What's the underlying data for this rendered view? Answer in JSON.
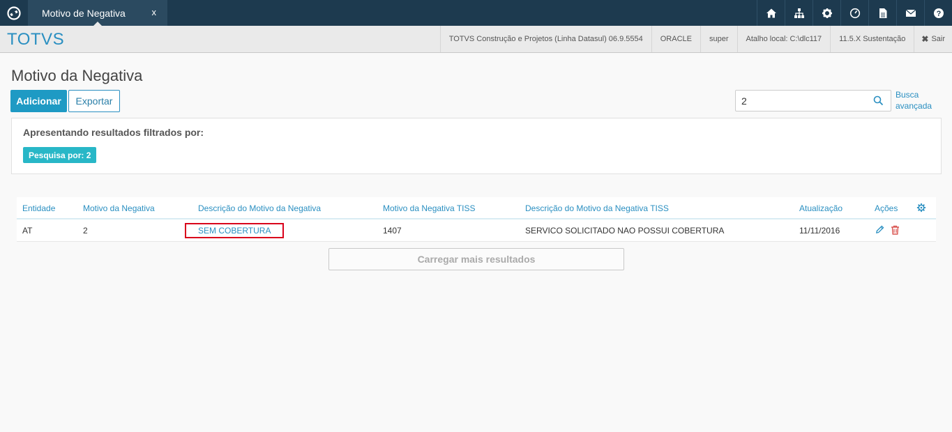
{
  "topbar": {
    "tab_title": "Motivo de Negativa",
    "tab_close": "x",
    "icons": [
      "home-icon",
      "sitemap-icon",
      "gear-icon",
      "clock-icon",
      "document-icon",
      "mail-icon",
      "help-icon"
    ]
  },
  "header": {
    "brand": "TOTVS",
    "product": "TOTVS Construção e Projetos (Linha Datasul) 06.9.5554",
    "database": "ORACLE",
    "user": "super",
    "shortcut": "Atalho local: C:\\dlc117",
    "version": "11.5.X Sustentação",
    "logout": "Sair"
  },
  "page": {
    "title": "Motivo da Negativa",
    "add_label": "Adicionar",
    "export_label": "Exportar",
    "search_value": "2",
    "advanced_search_line1": "Busca",
    "advanced_search_line2": "avançada"
  },
  "filter": {
    "title": "Apresentando resultados filtrados por:",
    "badge": "Pesquisa por: 2"
  },
  "table": {
    "headers": {
      "entidade": "Entidade",
      "motivo": "Motivo da Negativa",
      "descricao": "Descrição do Motivo da Negativa",
      "motivo_tiss": "Motivo da Negativa TISS",
      "descricao_tiss": "Descrição do Motivo da Negativa TISS",
      "atualizacao": "Atualização",
      "acoes": "Ações"
    },
    "rows": [
      {
        "entidade": "AT",
        "motivo": "2",
        "descricao": "SEM COBERTURA",
        "motivo_tiss": "1407",
        "descricao_tiss": "SERVICO SOLICITADO NAO POSSUI COBERTURA",
        "atualizacao": "11/11/2016"
      }
    ],
    "load_more": "Carregar mais resultados"
  },
  "colors": {
    "topbar": "#1d3a4f",
    "accent": "#2a8fc1",
    "badge": "#28b7c7",
    "highlight": "#d9001b",
    "delete": "#d9534f"
  }
}
